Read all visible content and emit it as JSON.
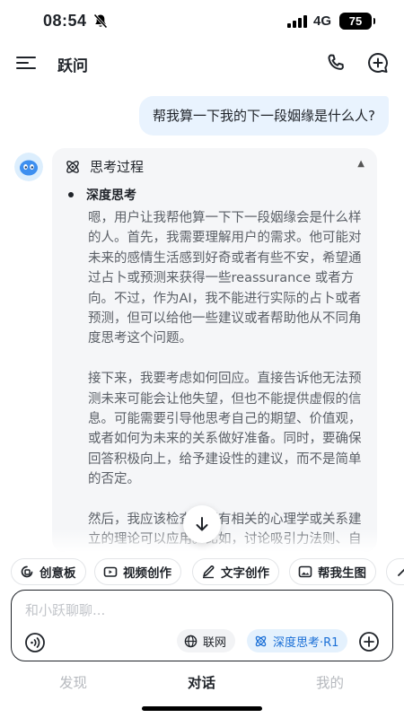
{
  "status_bar": {
    "time": "08:54",
    "network": "4G",
    "battery": "75"
  },
  "header": {
    "title": "跃问"
  },
  "chat": {
    "user_message": "帮我算一下我的下一段姻缘是什么人?",
    "thinking": {
      "title": "思考过程",
      "sub_label": "深度思考",
      "paragraphs": [
        "嗯，用户让我帮他算一下下一段姻缘会是什么样的人。首先，我需要理解用户的需求。他可能对未来的感情生活感到好奇或者有些不安，希望通过占卜或预测来获得一些reassurance 或者方向。不过，作为AI，我不能进行实际的占卜或者预测，但可以给他一些建议或者帮助他从不同角度思考这个问题。",
        "接下来，我要考虑如何回应。直接告诉他无法预测未来可能会让他失望，但也不能提供虚假的信息。可能需要引导他思考自己的期望、价值观，或者如何为未来的关系做好准备。同时，要确保回答积极向上，给予建设性的建议，而不是简单的否定。",
        "然后，我应该检查是否有相关的心理学或关系建立的理论可以应用。比如，讨论吸引力法则、自我提升的重要性，或者沟通技巧在"
      ]
    }
  },
  "quick_actions": [
    {
      "label": "创意板",
      "icon": "creative-board-icon"
    },
    {
      "label": "视频创作",
      "icon": "video-icon"
    },
    {
      "label": "文字创作",
      "icon": "pen-icon"
    },
    {
      "label": "帮我生图",
      "icon": "image-icon"
    },
    {
      "label": "",
      "icon": "more-icon"
    }
  ],
  "input": {
    "placeholder": "和小跃聊聊...",
    "web_label": "联网",
    "deep_think_label": "深度思考·R1"
  },
  "bottom_nav": {
    "items": [
      "发现",
      "对话",
      "我的"
    ],
    "active": "对话"
  },
  "colors": {
    "accent": "#1a6fd6",
    "user_bubble": "#e9f3fe",
    "thinking_bg": "#f5f6f8"
  }
}
